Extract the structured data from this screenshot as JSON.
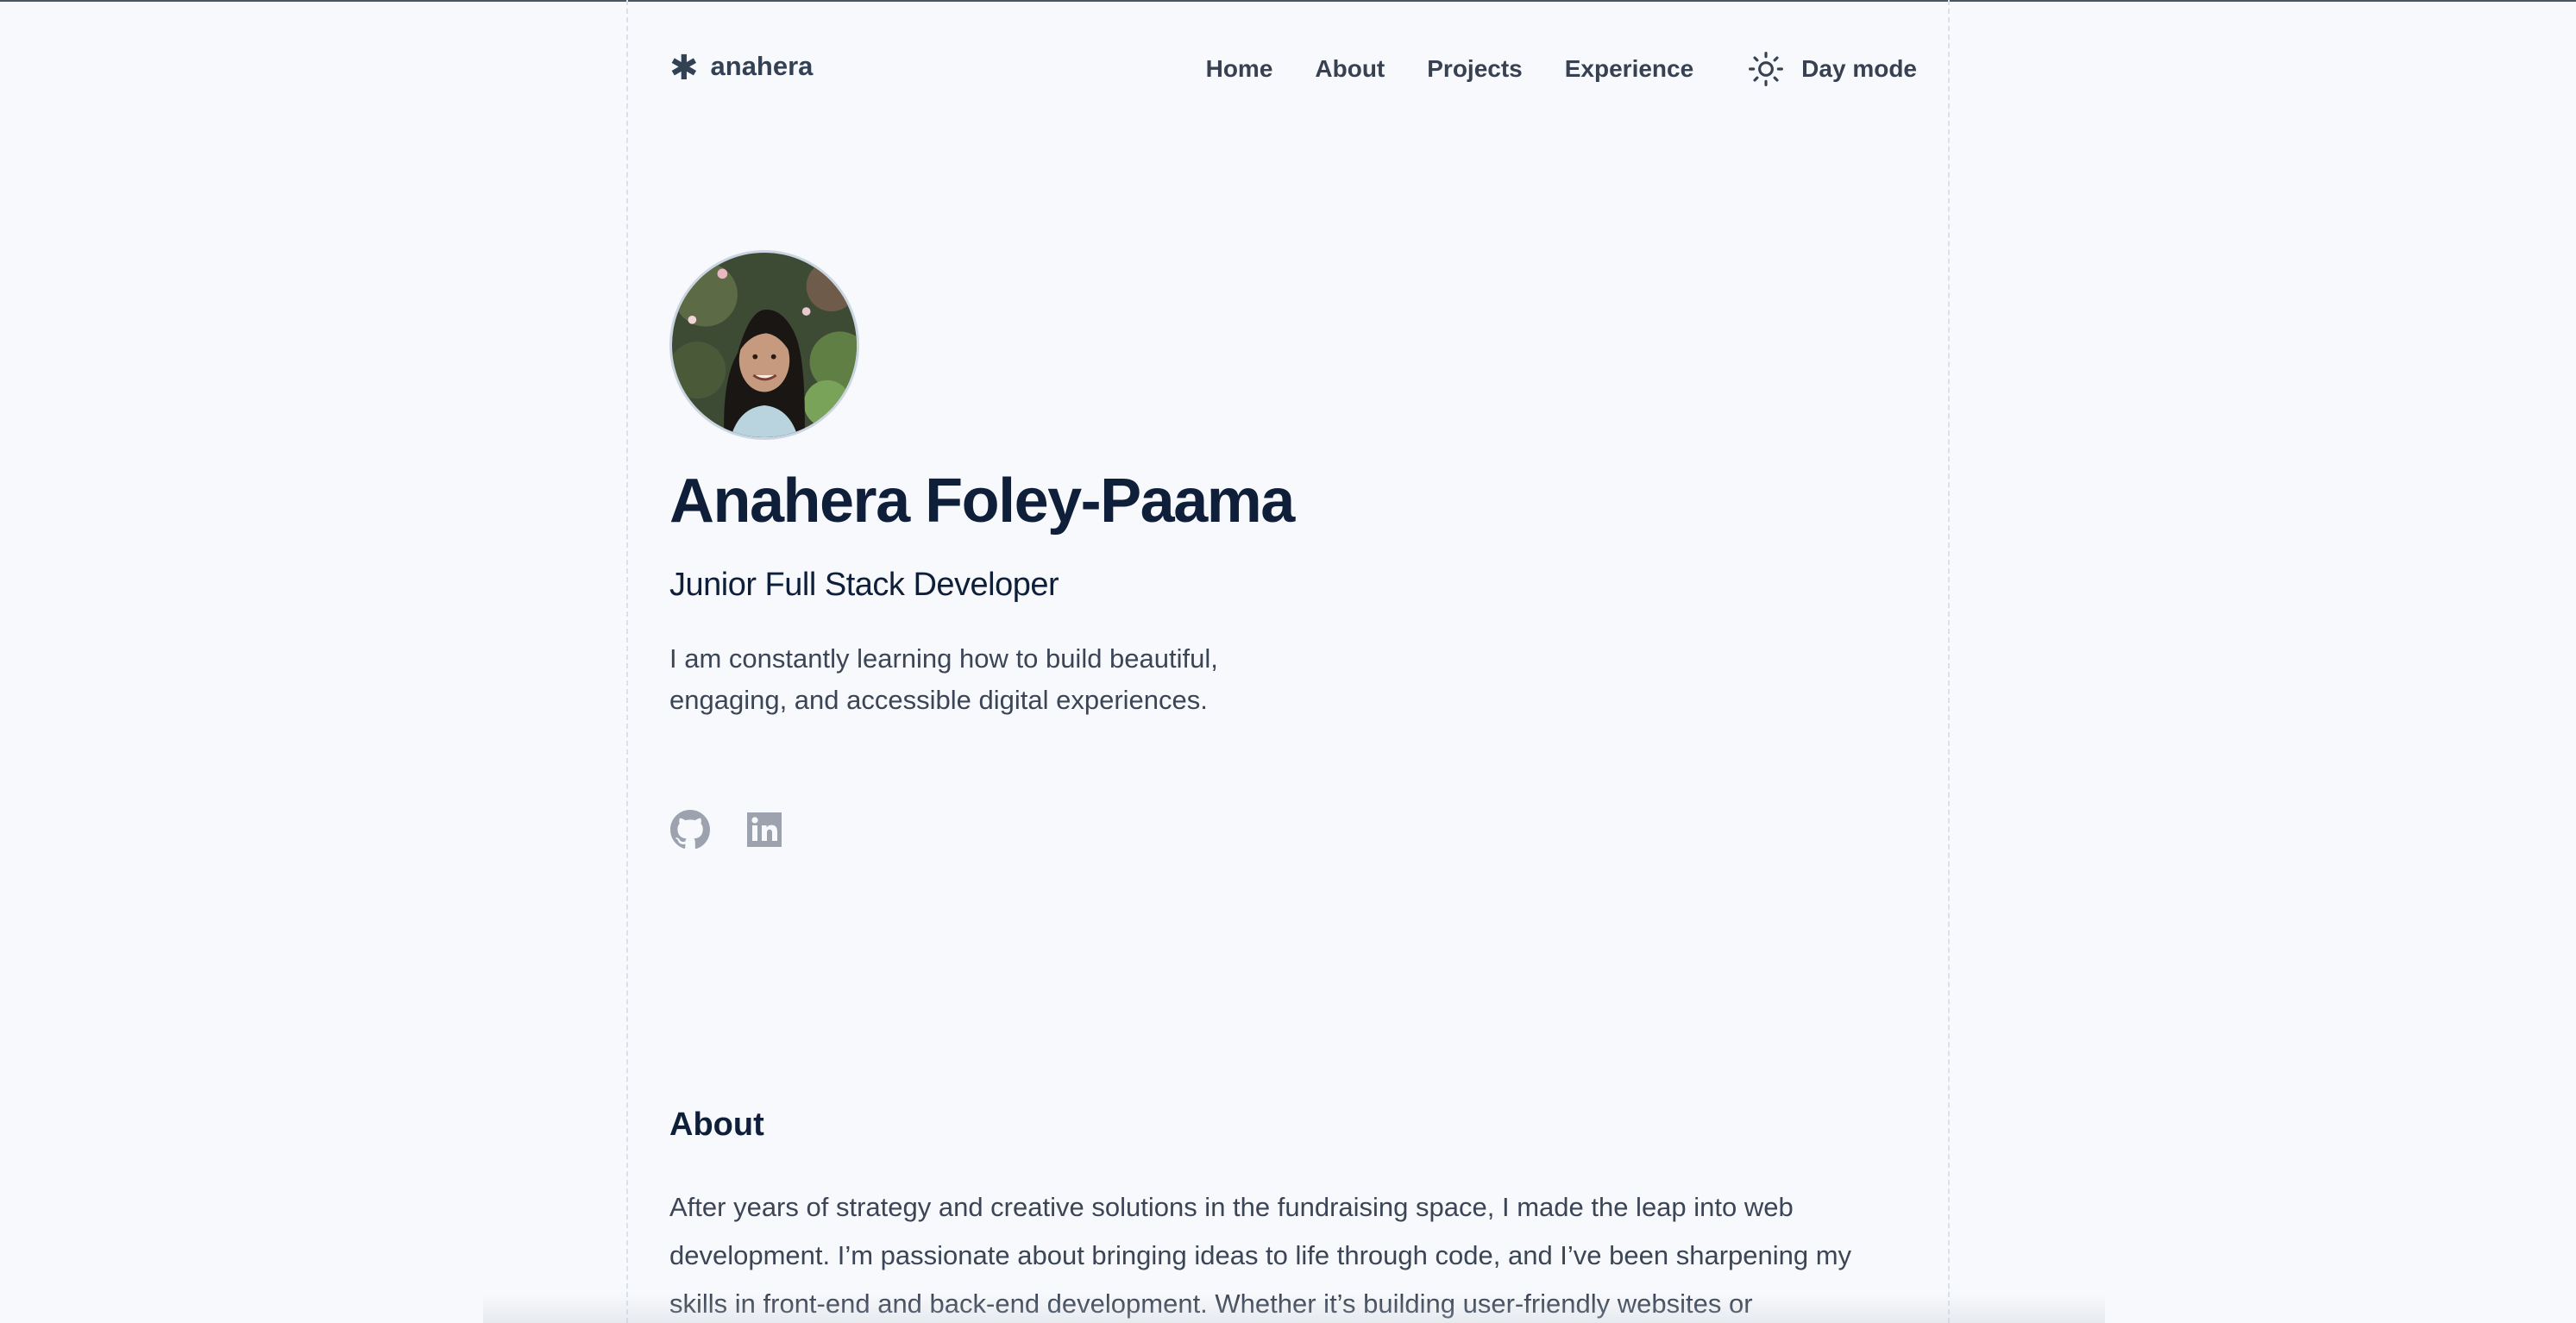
{
  "brand": {
    "icon": "asterisk-icon",
    "name": "anahera"
  },
  "nav": {
    "items": [
      {
        "label": "Home"
      },
      {
        "label": "About"
      },
      {
        "label": "Projects"
      },
      {
        "label": "Experience"
      }
    ],
    "mode_label": "Day mode",
    "mode_icon": "sun-icon"
  },
  "hero": {
    "name": "Anahera Foley-Paama",
    "role": "Junior Full Stack Developer",
    "tagline": "I am constantly learning how to build beautiful, engaging, and accessible digital experiences.",
    "socials": [
      {
        "icon": "github-icon"
      },
      {
        "icon": "linkedin-icon"
      }
    ]
  },
  "about": {
    "heading": "About",
    "text": "After years of strategy and creative solutions in the fundraising space, I made the leap into web development. I’m passionate about bringing ideas to life through code, and I’ve been sharpening my skills in front-end and back-end development. Whether it’s building user-friendly websites or"
  },
  "colors": {
    "background": "#f7f9fc",
    "heading": "#0f1f3a",
    "body_text": "#3b4556",
    "social_icon": "#9ca3af"
  }
}
